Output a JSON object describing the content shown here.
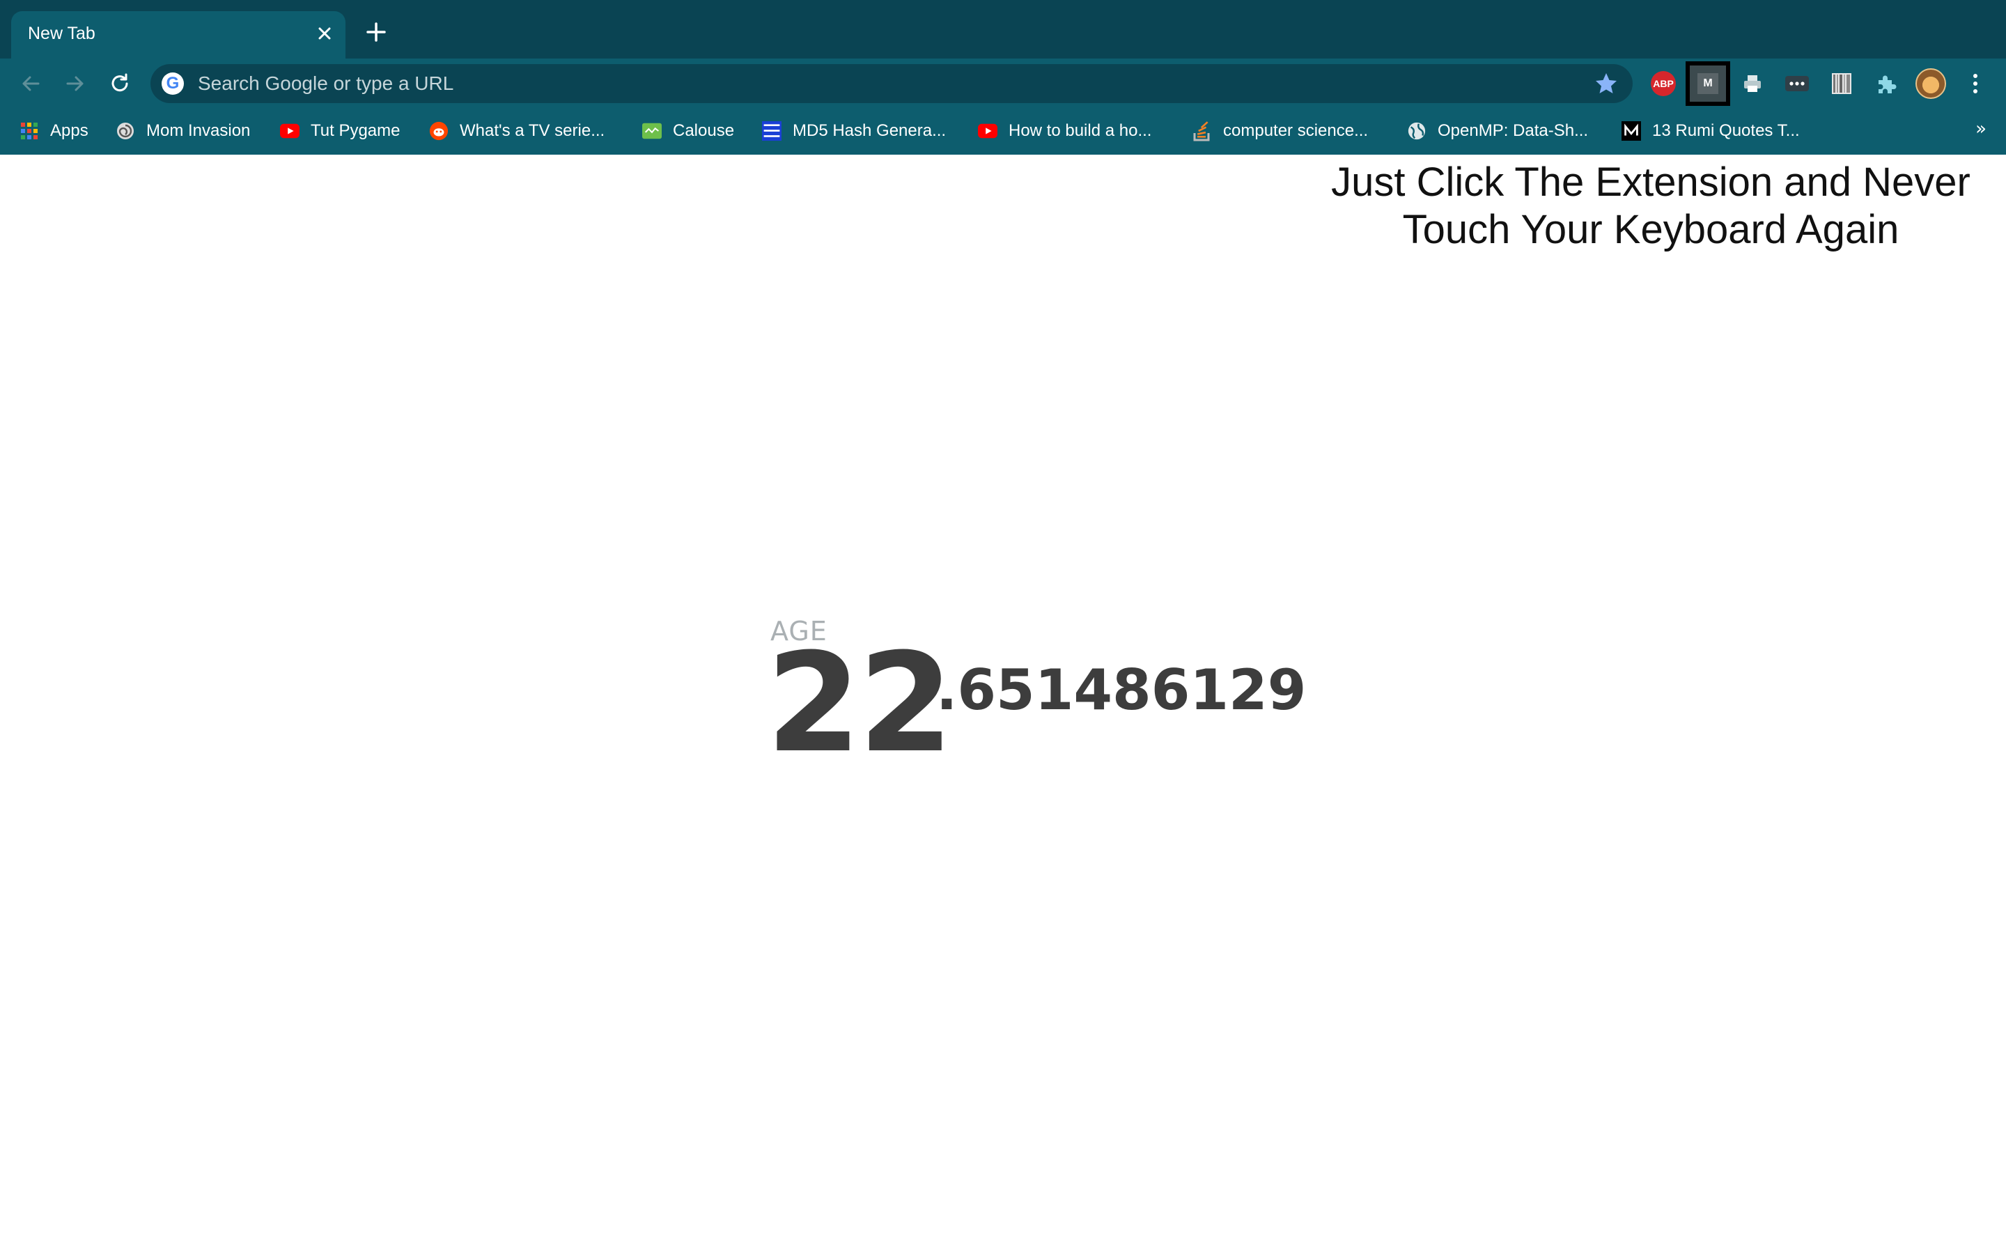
{
  "browser": {
    "tab": {
      "title": "New Tab"
    },
    "omnibox": {
      "placeholder": "Search Google or type a URL"
    },
    "extensions": {
      "abp_label": "ABP",
      "highlighted_label": "M"
    },
    "bookmarks": [
      {
        "label": "Apps",
        "icon": "apps-grid-icon"
      },
      {
        "label": "Mom Invasion",
        "icon": "spiral-icon"
      },
      {
        "label": "Tut Pygame",
        "icon": "youtube-icon"
      },
      {
        "label": "What's a TV serie...",
        "icon": "reddit-icon"
      },
      {
        "label": "Calouse",
        "icon": "calouse-icon"
      },
      {
        "label": "MD5 Hash Genera...",
        "icon": "md5-site-icon"
      },
      {
        "label": "How to build a ho...",
        "icon": "youtube-icon"
      },
      {
        "label": "computer science...",
        "icon": "stackoverflow-icon"
      },
      {
        "label": "OpenMP: Data-Sh...",
        "icon": "globe-icon"
      },
      {
        "label": "13 Rumi Quotes T...",
        "icon": "medium-icon"
      }
    ],
    "bookmarks_overflow": "»"
  },
  "page": {
    "promo_line1": "Just Click The Extension and Never",
    "promo_line2": "Touch Your Keyboard Again",
    "age_label": "AGE",
    "age_integer": "22",
    "age_fraction": ".651486129"
  },
  "colors": {
    "tabstrip": "#0a4453",
    "toolbar": "#0d5d6e",
    "age_text": "#3d3d3d",
    "age_label": "#aab0b3"
  }
}
